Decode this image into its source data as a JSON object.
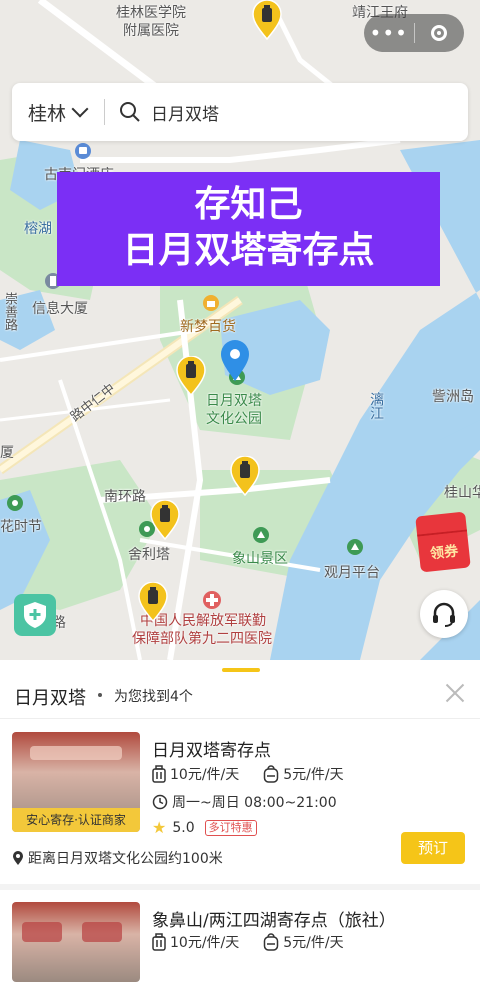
{
  "top_bar": {
    "more_glyph": "•••"
  },
  "search": {
    "city": "桂林",
    "query": "日月双塔"
  },
  "banner": {
    "line1": "存知己",
    "line2": "日月双塔寄存点"
  },
  "map_labels": {
    "hospital_top": "桂林医学院\n附属医院",
    "jingjiang": "靖江王府",
    "gunanmen": "古南门酒店",
    "rong_lake": "榕湖",
    "xinxin": "信息大厦",
    "xinmeng": "新梦百货",
    "road_lin": "路中仁中",
    "riyue_park_1": "日月双塔",
    "riyue_park_2": "文化公园",
    "li_river": "漓江",
    "zizhou": "訾洲岛",
    "nanhuan": "南环路",
    "sheli": "舍利塔",
    "xiangshan": "象山景区",
    "guiyuan": "桂山华",
    "guanyue": "观月平台",
    "huashi": "花时节",
    "hou": "厦",
    "road_lu": "路",
    "army_1": "中国人民解放军联勤",
    "army_2": "保障部队第九二四医院",
    "left_vertical": "崇善路"
  },
  "red_packet": {
    "label": "领券"
  },
  "results": {
    "title": "日月双塔",
    "count_text": "为您找到4个"
  },
  "listings": [
    {
      "name": "日月双塔寄存点",
      "tag": "安心寄存·认证商家",
      "price_large": "10元/件/天",
      "price_small": "5元/件/天",
      "hours": "周一~周日 08:00~21:00",
      "rating": "5.0",
      "badge": "多订特惠",
      "distance": "距离日月双塔文化公园约100米",
      "book": "预订"
    },
    {
      "name": "象鼻山/两江四湖寄存点（旅社）",
      "price_large": "10元/件/天",
      "price_small": "5元/件/天"
    }
  ],
  "icons": [
    "luggage-pin-icon",
    "location-pin-icon",
    "search-icon",
    "chevron-down-icon",
    "close-icon",
    "headset-icon",
    "shield-plus-icon",
    "red-packet-icon",
    "suitcase-icon",
    "backpack-icon",
    "clock-icon",
    "star-icon",
    "map-marker-icon"
  ],
  "colors": {
    "banner": "#7b2ff5",
    "accent_yellow": "#f5c518",
    "river": "#a9d3f0",
    "park": "#c9e6c6"
  }
}
